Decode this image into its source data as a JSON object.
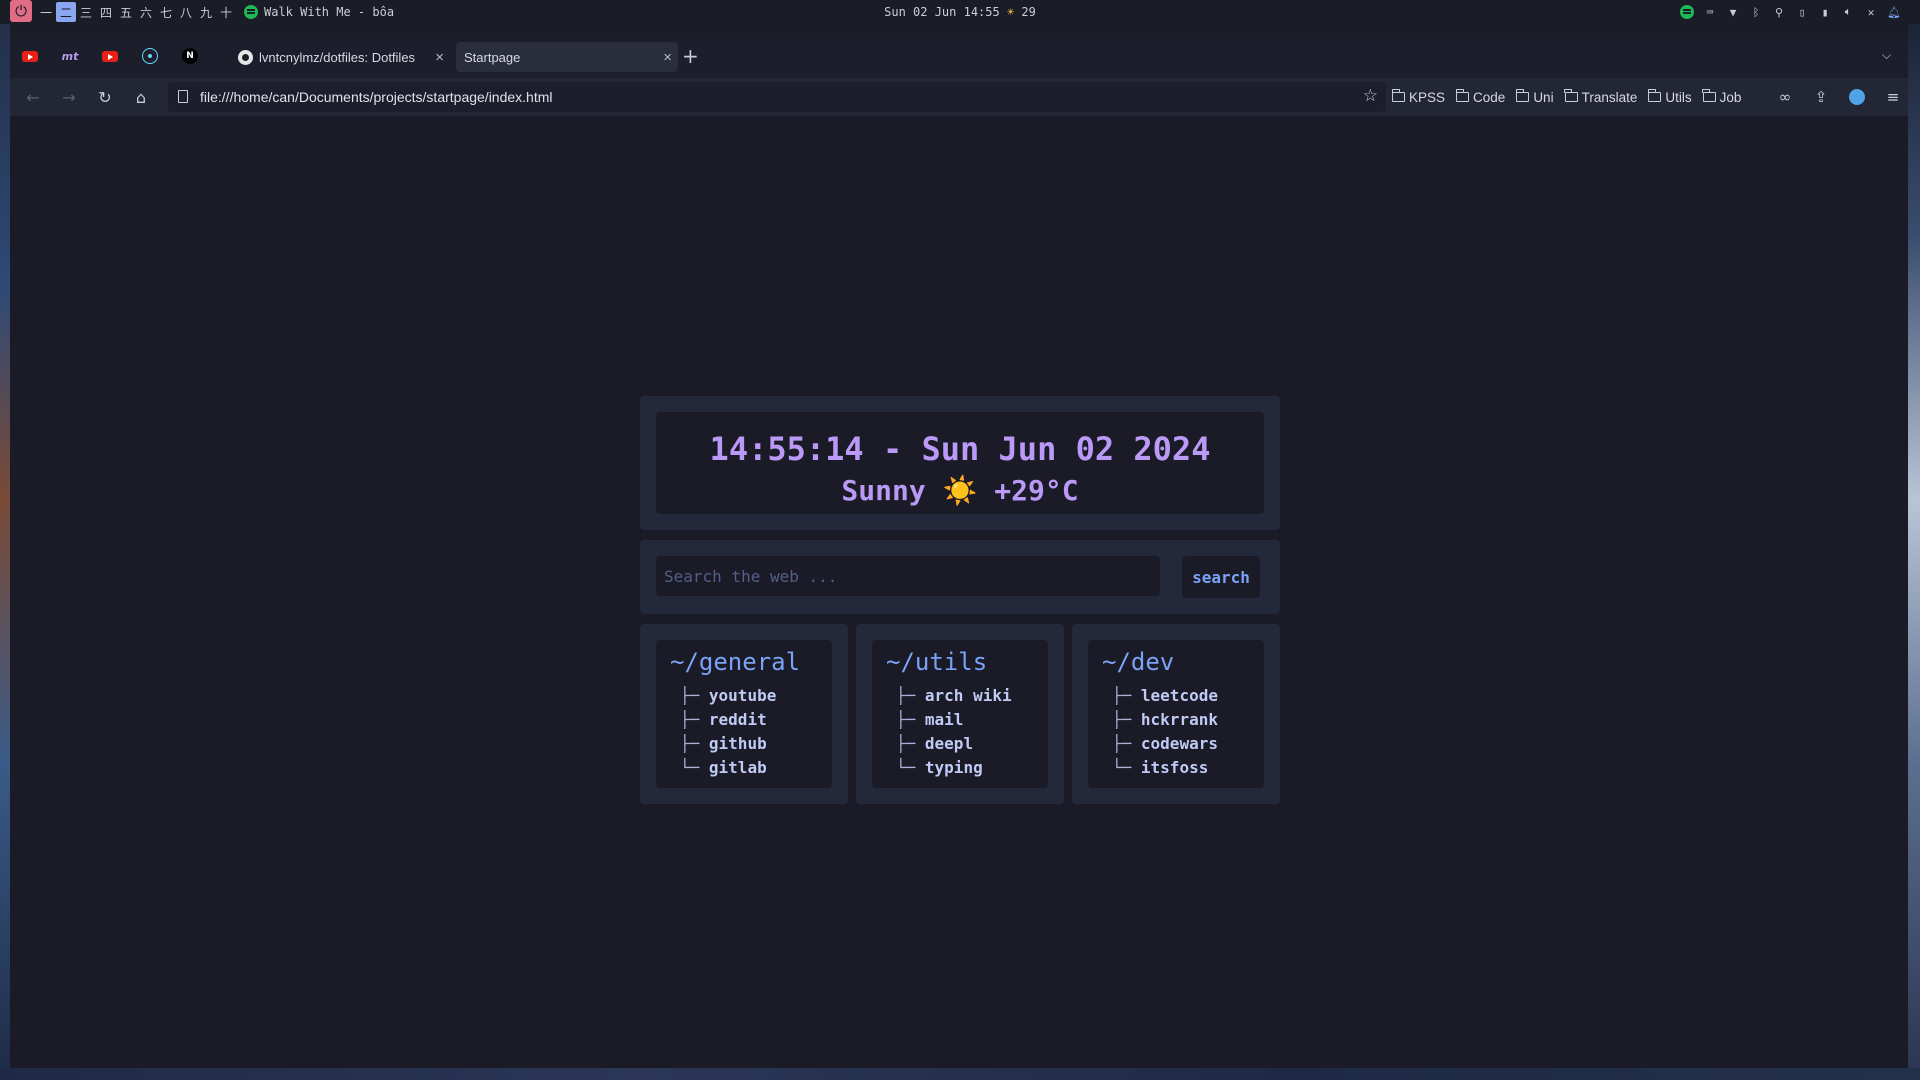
{
  "system_bar": {
    "workspaces": [
      "一",
      "二",
      "三",
      "四",
      "五",
      "六",
      "七",
      "八",
      "九",
      "十"
    ],
    "active_workspace": 1,
    "now_playing": "Walk With Me - bôa",
    "clock": "Sun 02 Jun 14:55",
    "weather_icon": "☀",
    "temperature": "29",
    "tray_icons": [
      "spotify-icon",
      "keyboard-icon",
      "wifi-icon",
      "bluetooth-icon",
      "location-icon",
      "phone-icon",
      "battery-icon",
      "volume-icon",
      "mic-muted-icon",
      "notification-icon"
    ]
  },
  "browser": {
    "tabs": [
      {
        "title": "lvntcnylmz/dotfiles: Dotfiles",
        "icon": "github-icon"
      },
      {
        "title": "Startpage",
        "icon": "none",
        "selected": true
      }
    ],
    "pinned_tabs": [
      "youtube-icon",
      "mt-icon",
      "youtube-icon",
      "react-icon",
      "notion-icon"
    ],
    "url": "file:///home/can/Documents/projects/startpage/index.html",
    "bookmarks": [
      "KPSS",
      "Code",
      "Uni",
      "Translate",
      "Utils",
      "Job"
    ],
    "pinned_mt_label": "mt"
  },
  "startpage": {
    "datetime": "14:55:14 - Sun Jun 02 2024",
    "weather": "Sunny ☀️ +29°C",
    "search": {
      "placeholder": "Search the web ...",
      "button": "search"
    },
    "columns": [
      {
        "title": "~/general",
        "links": [
          "youtube",
          "reddit",
          "github",
          "gitlab"
        ]
      },
      {
        "title": "~/utils",
        "links": [
          "arch wiki",
          "mail",
          "deepl",
          "typing"
        ]
      },
      {
        "title": "~/dev",
        "links": [
          "leetcode",
          "hckrrank",
          "codewars",
          "itsfoss"
        ]
      }
    ]
  },
  "colors": {
    "accent_purple": "#bb9af7",
    "accent_blue": "#7aa2f7",
    "panel_bg": "#24283b",
    "page_bg": "#1a1b26"
  }
}
